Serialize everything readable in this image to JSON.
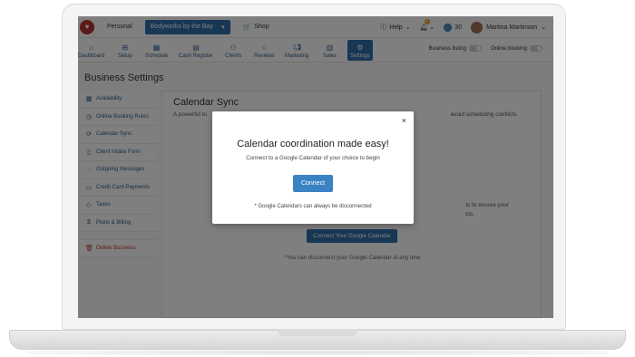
{
  "topbar": {
    "personal": "Personal",
    "business": "Bodyworks by the Bay",
    "shop": "Shop",
    "help": "Help",
    "notifications": "0",
    "points": "30",
    "user": "Martina Martinson"
  },
  "nav": {
    "items": [
      {
        "label": "Dashboard",
        "icon": "dashboard-icon"
      },
      {
        "label": "Setup",
        "icon": "setup-icon"
      },
      {
        "label": "Schedule",
        "icon": "calendar-icon"
      },
      {
        "label": "Cash Register",
        "icon": "register-icon"
      },
      {
        "label": "Clients",
        "icon": "clients-icon"
      },
      {
        "label": "Reviews",
        "icon": "star-icon"
      },
      {
        "label": "Marketing",
        "icon": "megaphone-icon"
      },
      {
        "label": "Sales",
        "icon": "bar-chart-icon"
      },
      {
        "label": "Settings",
        "icon": "gear-icon"
      }
    ],
    "active": "Settings",
    "business_listing": "Business listing",
    "online_booking": "Online booking"
  },
  "page": {
    "title": "Business Settings"
  },
  "sidebar": {
    "items": [
      {
        "label": "Availability"
      },
      {
        "label": "Online Booking Rules"
      },
      {
        "label": "Calendar Sync"
      },
      {
        "label": "Client Intake Form"
      },
      {
        "label": "Outgoing Messages"
      },
      {
        "label": "Credit Card Payments"
      },
      {
        "label": "Taxes"
      },
      {
        "label": "Plans & Billing"
      }
    ],
    "delete": "Delete Business"
  },
  "content": {
    "title": "Calendar Sync",
    "desc_start": "A powerful to",
    "desc_end": "avoid scheduling conflicts.",
    "mid_line1": "ts to ensure your",
    "mid_line2": "cts.",
    "button": "Connect Your Google Calendar",
    "footnote": "*You can disconnect your Google Calendar at any time"
  },
  "modal": {
    "close": "×",
    "title": "Calendar coordination made easy!",
    "subtitle": "Connect to a Google Calendar of your choice to begin",
    "button": "Connect",
    "note": "* Google Calendars can always be disconnected"
  }
}
